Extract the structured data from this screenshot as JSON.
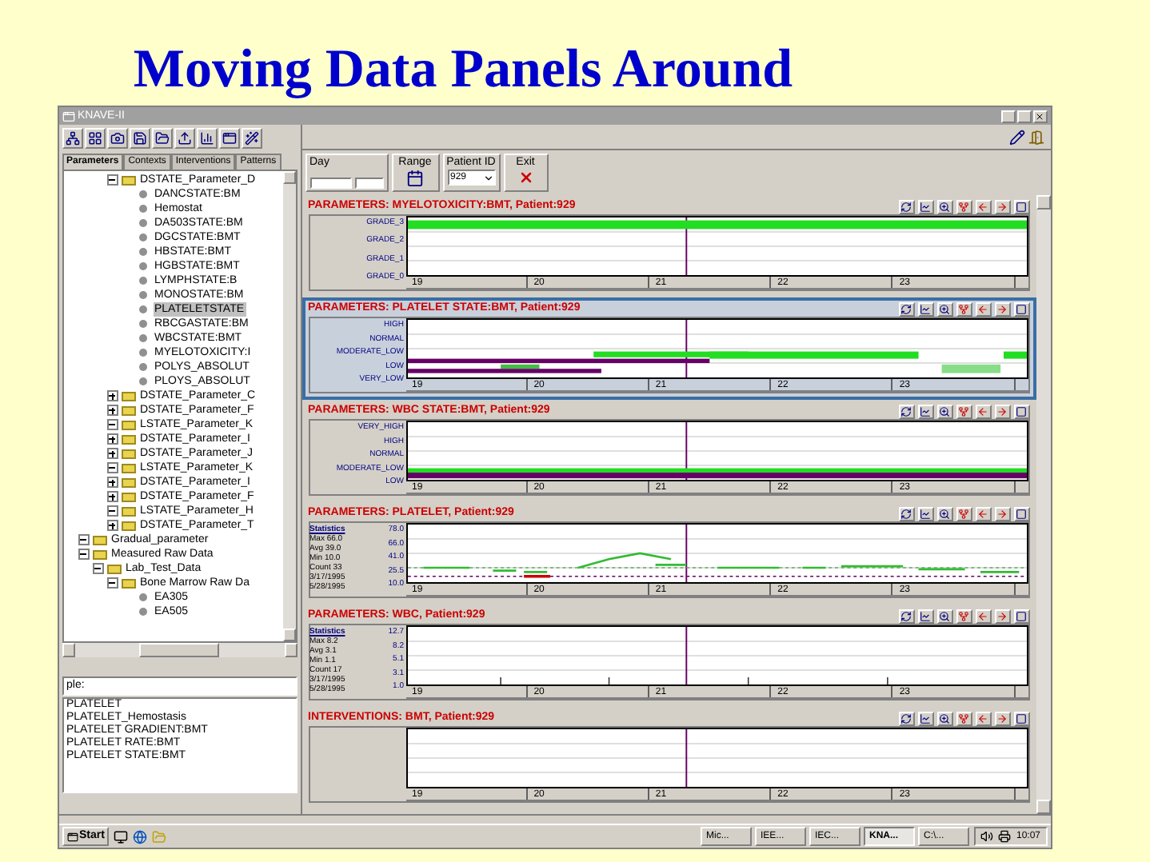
{
  "slide_title": "Moving Data Panels Around",
  "window": {
    "title": "KNAVE-II"
  },
  "left_tabs": [
    {
      "label": "Parameters",
      "selected": true
    },
    {
      "label": "Contexts",
      "selected": false
    },
    {
      "label": "Interventions",
      "selected": false
    },
    {
      "label": "Patterns",
      "selected": false
    }
  ],
  "tree": {
    "partial_branch": [
      {
        "label": "DSTATE_Parameter_D",
        "kind": "folder",
        "expanded": true,
        "selected": false,
        "children": [
          {
            "label": "DANCSTATE:BM",
            "kind": "leaf",
            "selected": false
          },
          {
            "label": "Hemostat",
            "kind": "leaf",
            "selected": false
          },
          {
            "label": "DA503STATE:BM",
            "kind": "leaf",
            "selected": false
          },
          {
            "label": "DGCSTATE:BMT",
            "kind": "leaf",
            "selected": false
          },
          {
            "label": "HBSTATE:BMT",
            "kind": "leaf",
            "selected": false
          },
          {
            "label": "HGBSTATE:BMT",
            "kind": "leaf",
            "selected": false
          },
          {
            "label": "LYMPHSTATE:B",
            "kind": "leaf",
            "selected": false
          },
          {
            "label": "MONOSTATE:BM",
            "kind": "leaf",
            "selected": false
          },
          {
            "label": "PLATELETSTATE",
            "kind": "leaf",
            "selected": true
          },
          {
            "label": "RBCGASTATE:BM",
            "kind": "leaf",
            "selected": false
          },
          {
            "label": "WBCSTATE:BMT",
            "kind": "leaf",
            "selected": false
          },
          {
            "label": "MYELOTOXICITY:I",
            "kind": "leaf",
            "selected": false
          },
          {
            "label": "POLYS_ABSOLUT",
            "kind": "leaf",
            "selected": false
          },
          {
            "label": "PLOYS_ABSOLUT",
            "kind": "leaf",
            "selected": false
          }
        ]
      },
      {
        "label": "DSTATE_Parameter_C",
        "kind": "folder",
        "expanded": false,
        "selected": false
      },
      {
        "label": "DSTATE_Parameter_F",
        "kind": "folder",
        "expanded": false,
        "selected": false
      },
      {
        "label": "LSTATE_Parameter_K",
        "kind": "folder",
        "expanded": true,
        "selected": false
      },
      {
        "label": "DSTATE_Parameter_I",
        "kind": "folder",
        "expanded": false,
        "selected": false
      },
      {
        "label": "DSTATE_Parameter_J",
        "kind": "folder",
        "expanded": false,
        "selected": false
      },
      {
        "label": "LSTATE_Parameter_K",
        "kind": "folder",
        "expanded": true,
        "selected": false
      },
      {
        "label": "DSTATE_Parameter_I",
        "kind": "folder",
        "expanded": false,
        "selected": false
      },
      {
        "label": "DSTATE_Parameter_F",
        "kind": "folder",
        "expanded": false,
        "selected": false
      },
      {
        "label": "LSTATE_Parameter_H",
        "kind": "folder",
        "expanded": true,
        "selected": false
      },
      {
        "label": "DSTATE_Parameter_T",
        "kind": "folder",
        "expanded": false,
        "selected": false
      }
    ],
    "items": [
      {
        "label": "Gradual_parameter",
        "kind": "folder",
        "expanded": true,
        "selected": false
      },
      {
        "label": "Measured Raw Data",
        "kind": "folder",
        "expanded": true,
        "selected": false,
        "children": [
          {
            "label": "Lab_Test_Data",
            "kind": "folder",
            "expanded": true,
            "selected": false,
            "children": [
              {
                "label": "Bone Marrow Raw Da",
                "kind": "folder",
                "expanded": true,
                "selected": false,
                "children": [
                  {
                    "label": "EA305",
                    "kind": "leaf",
                    "selected": false
                  },
                  {
                    "label": "EA505",
                    "kind": "leaf",
                    "selected": false
                  }
                ]
              }
            ]
          }
        ]
      }
    ]
  },
  "search": {
    "value": "ple:"
  },
  "results": [
    "PLATELET",
    "PLATELET_Hemostasis",
    "PLATELET GRADIENT:BMT",
    "PLATELET RATE:BMT",
    "PLATELET STATE:BMT"
  ],
  "controls": {
    "day_label": "Day",
    "range_label": "Range",
    "patient_label": "Patient ID",
    "patient_value": "929",
    "exit_label": "Exit"
  },
  "panels": [
    {
      "title": "PARAMETERS: MYELOTOXICITY:BMT, Patient:929",
      "kind": "state",
      "selected": false,
      "y_labels": [
        "GRADE_3",
        "GRADE_2",
        "GRADE_1",
        "GRADE_0"
      ],
      "x_ticks": [
        "19",
        "20",
        "21",
        "22",
        "23"
      ]
    },
    {
      "title": "PARAMETERS: PLATELET STATE:BMT, Patient:929",
      "kind": "state",
      "selected": true,
      "y_labels": [
        "HIGH",
        "NORMAL",
        "MODERATE_LOW",
        "LOW",
        "VERY_LOW"
      ],
      "x_ticks": [
        "19",
        "20",
        "21",
        "22",
        "23"
      ]
    },
    {
      "title": "PARAMETERS: WBC STATE:BMT, Patient:929",
      "kind": "state",
      "selected": false,
      "y_labels": [
        "VERY_HIGH",
        "HIGH",
        "NORMAL",
        "MODERATE_LOW",
        "LOW"
      ],
      "x_ticks": [
        "19",
        "20",
        "21",
        "22",
        "23"
      ]
    },
    {
      "title": "PARAMETERS: PLATELET, Patient:929",
      "kind": "stats",
      "selected": false,
      "stats": [
        "Statistics",
        "Max 66.0",
        "Avg 39.0",
        "Min 10.0",
        "Count 33",
        "3/17/1995",
        "5/28/1995"
      ],
      "y_labels": [
        "78.0",
        "66.0",
        "41.0",
        "25.5",
        "10.0"
      ],
      "x_ticks": [
        "19",
        "20",
        "21",
        "22",
        "23"
      ]
    },
    {
      "title": "PARAMETERS: WBC, Patient:929",
      "kind": "stats",
      "selected": false,
      "stats": [
        "Statistics",
        "Max 8.2",
        "Avg 3.1",
        "Min 1.1",
        "Count 17",
        "3/17/1995",
        "5/28/1995"
      ],
      "y_labels": [
        "12.7",
        "8.2",
        "5.1",
        "3.1",
        "1.0"
      ],
      "x_ticks": [
        "19",
        "20",
        "21",
        "22",
        "23"
      ]
    },
    {
      "title": "INTERVENTIONS: BMT, Patient:929",
      "kind": "interventions",
      "selected": false,
      "x_ticks": [
        "19",
        "20",
        "21",
        "22",
        "23"
      ]
    }
  ],
  "taskbar": {
    "start": "Start",
    "tasks": [
      {
        "label": "Mic...",
        "selected": false
      },
      {
        "label": "IEE...",
        "selected": false
      },
      {
        "label": "IEC...",
        "selected": false
      },
      {
        "label": "KNA...",
        "selected": true
      },
      {
        "label": "C:\\...",
        "selected": false
      }
    ],
    "clock": "10:07"
  }
}
